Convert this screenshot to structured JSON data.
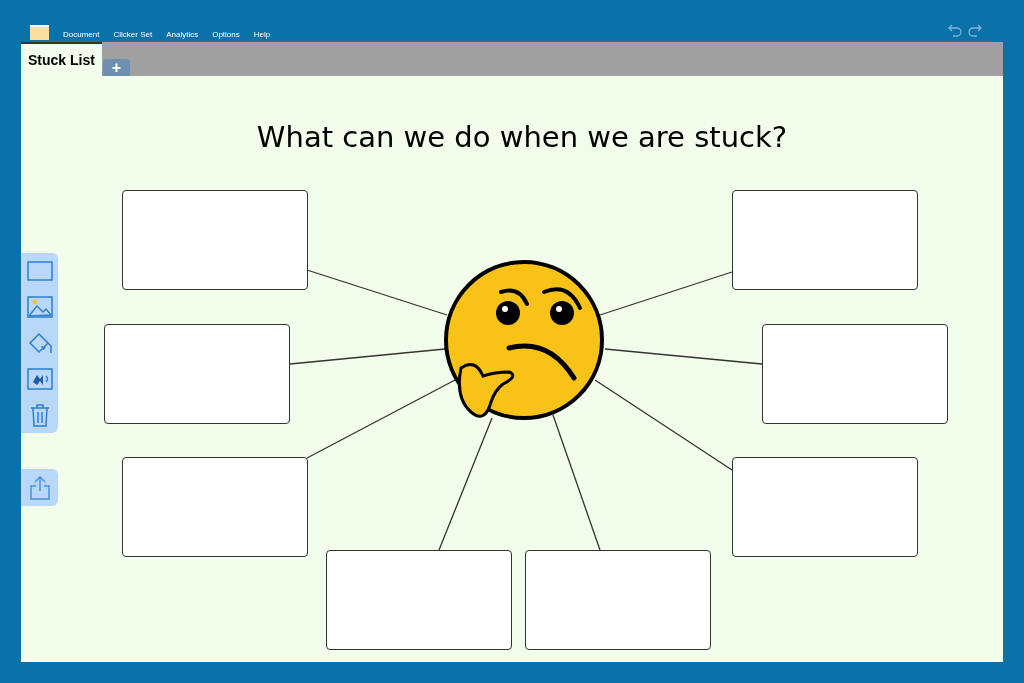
{
  "menu": [
    "Document",
    "Clicker Set",
    "Analytics",
    "Options",
    "Help"
  ],
  "tabs": [
    {
      "label": "Stuck List",
      "selected": true
    }
  ],
  "add_tab": "+",
  "page": {
    "title": "What can we do when we are stuck?"
  }
}
